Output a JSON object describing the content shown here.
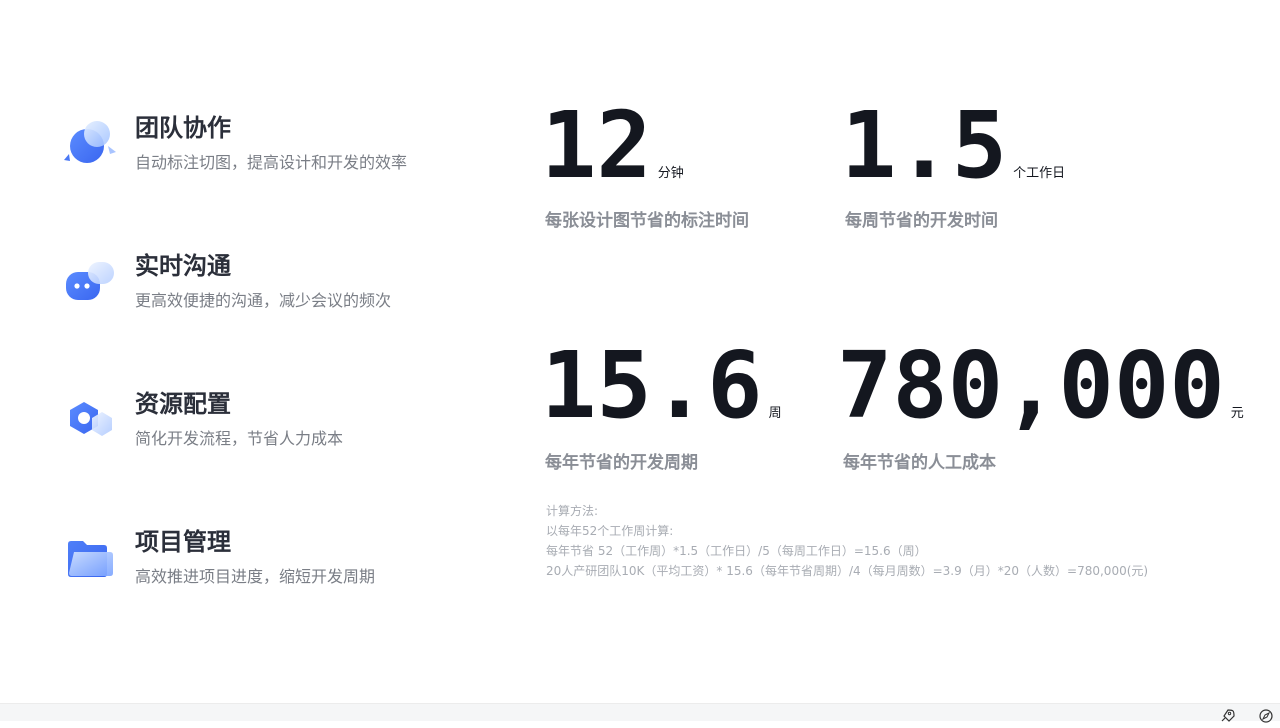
{
  "features": [
    {
      "title": "团队协作",
      "desc": "自动标注切图，提高设计和开发的效率",
      "icon": "team-collab-icon"
    },
    {
      "title": "实时沟通",
      "desc": "更高效便捷的沟通，减少会议的频次",
      "icon": "chat-bubble-icon"
    },
    {
      "title": "资源配置",
      "desc": "简化开发流程，节省人力成本",
      "icon": "hexagon-resource-icon"
    },
    {
      "title": "项目管理",
      "desc": "高效推进项目进度，缩短开发周期",
      "icon": "folder-icon"
    }
  ],
  "stats": [
    {
      "value": "12",
      "unit": "分钟",
      "label": "每张设计图节省的标注时间"
    },
    {
      "value": "1.5",
      "unit": "个工作日",
      "label": "每周节省的开发时间"
    },
    {
      "value": "15.6",
      "unit": "周",
      "label": "每年节省的开发周期"
    },
    {
      "value": "780,000",
      "unit": "元",
      "label": "每年节省的人工成本"
    }
  ],
  "method": {
    "title": "计算方法:",
    "line1": "以每年52个工作周计算:",
    "line2": "每年节省 52（工作周）*1.5（工作日）/5（每周工作日）=15.6（周）",
    "line3": "20人产研团队10K（平均工资）* 15.6（每年节省周期）/4（每月周数）=3.9（月）*20（人数）=780,000(元)"
  },
  "colors": {
    "accent_blue": "#3e6ef5",
    "light_blue": "#a9c4ff",
    "text_dark": "#2b2f3a",
    "text_muted": "#8a8e96"
  },
  "bottom_bar": {
    "icons": [
      "rocket-icon",
      "compass-icon"
    ]
  }
}
